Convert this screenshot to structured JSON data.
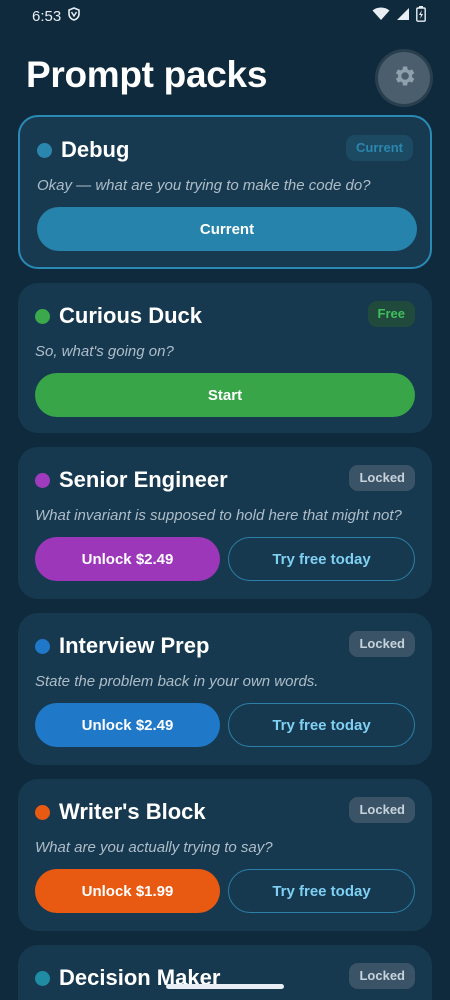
{
  "status_bar": {
    "time": "6:53",
    "app_icon": "vpn-shield-icon",
    "icons": [
      "wifi-icon",
      "signal-icon",
      "battery-icon"
    ]
  },
  "header": {
    "title": "Prompt packs",
    "settings_icon": "gear-icon"
  },
  "packs": [
    {
      "name": "Debug",
      "badge": "Current",
      "quote": "Okay — what are you trying to make the code do?",
      "primary_label": "Current",
      "dot_color": "#2a86ad",
      "button_color": "#2683ab"
    },
    {
      "name": "Curious Duck",
      "badge": "Free",
      "quote": "So, what's going on?",
      "primary_label": "Start",
      "dot_color": "#3aa84b",
      "button_color": "#37a548"
    },
    {
      "name": "Senior Engineer",
      "badge": "Locked",
      "quote": "What invariant is supposed to hold here that might not?",
      "unlock_label": "Unlock $2.49",
      "try_label": "Try free today",
      "dot_color": "#a03bbd",
      "button_color": "#9c37ba"
    },
    {
      "name": "Interview Prep",
      "badge": "Locked",
      "quote": "State the problem back in your own words.",
      "unlock_label": "Unlock $2.49",
      "try_label": "Try free today",
      "dot_color": "#1f78c8",
      "button_color": "#1f78c8"
    },
    {
      "name": "Writer's Block",
      "badge": "Locked",
      "quote": "What are you actually trying to say?",
      "unlock_label": "Unlock $1.99",
      "try_label": "Try free today",
      "dot_color": "#e85a12",
      "button_color": "#e85a12"
    },
    {
      "name": "Decision Maker",
      "badge": "Locked",
      "dot_color": "#1f8ca3"
    }
  ]
}
